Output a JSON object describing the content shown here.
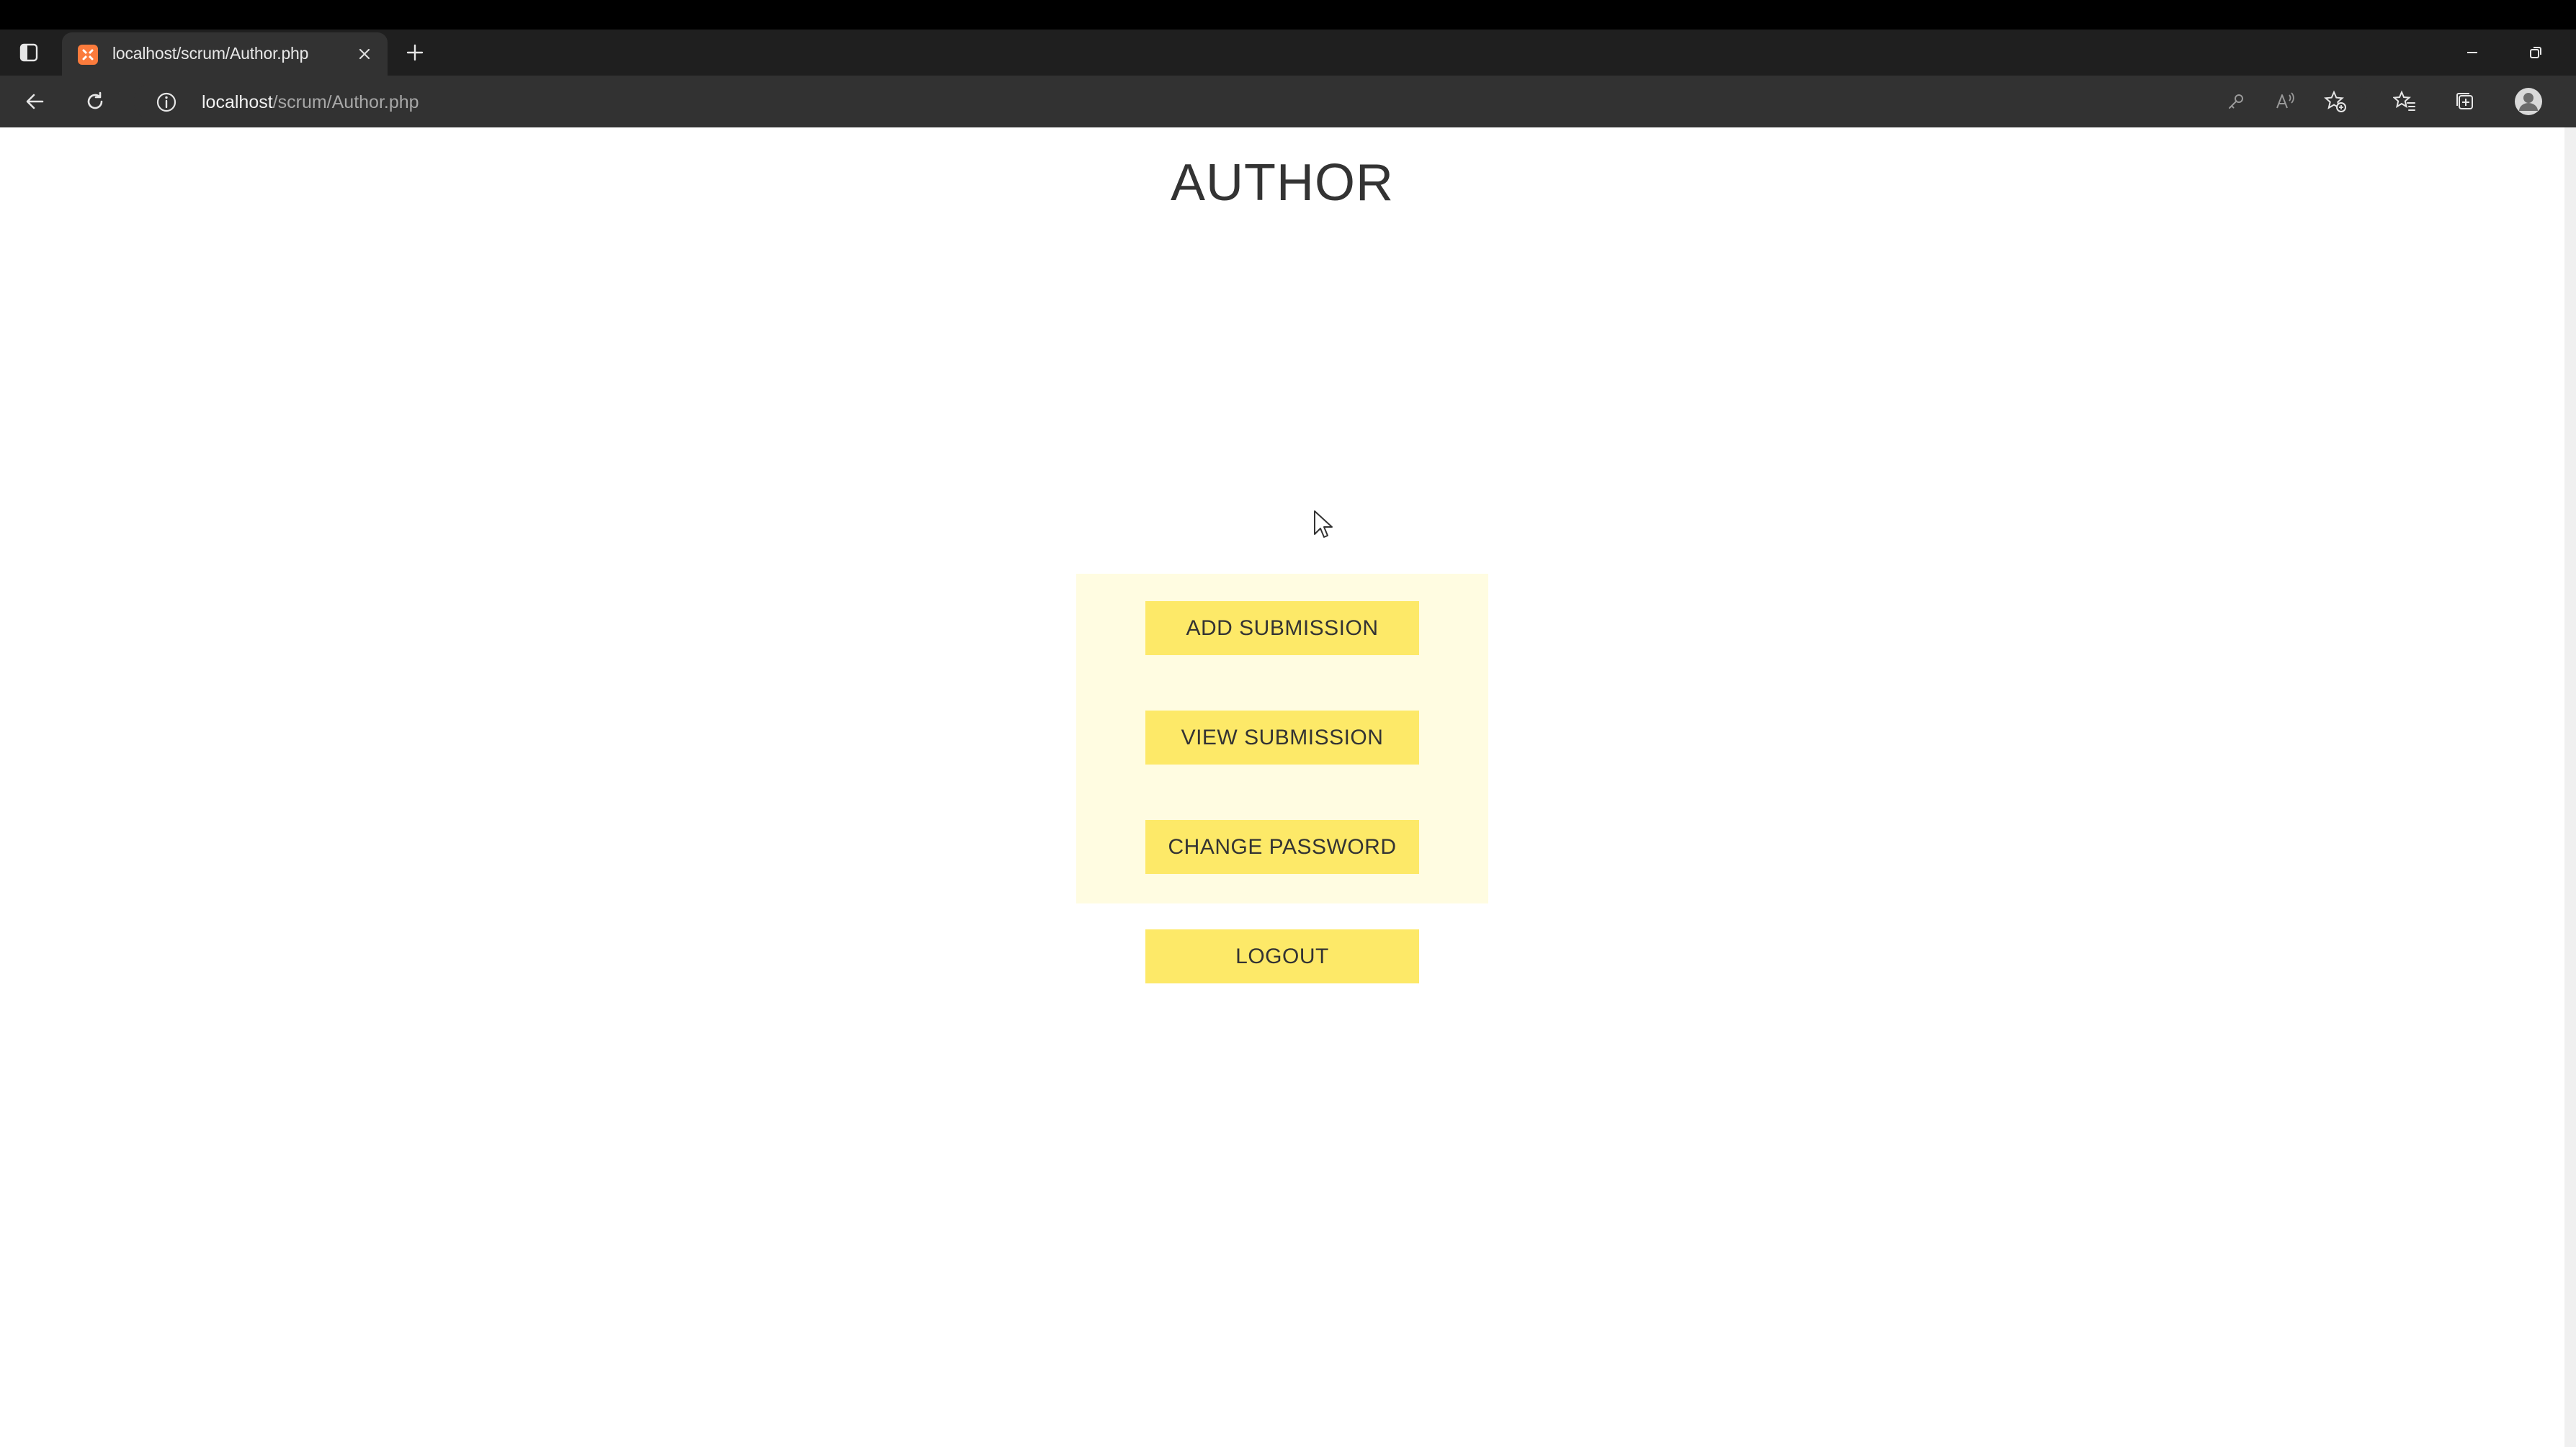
{
  "browser": {
    "tab": {
      "title": "localhost/scrum/Author.php"
    },
    "address": {
      "host": "localhost",
      "path": "/scrum/Author.php"
    },
    "icons": {
      "tab_actions": "tab-actions-icon",
      "favicon": "xampp-favicon",
      "close": "close-icon",
      "new_tab": "plus-icon",
      "minimize": "minimize-icon",
      "restore": "restore-icon",
      "back": "back-arrow-icon",
      "reload": "reload-icon",
      "site_info": "info-icon",
      "password": "key-icon",
      "read_aloud": "read-aloud-icon",
      "add_favorite": "star-add-icon",
      "favorites": "favorites-icon",
      "collections": "collections-icon",
      "profile": "profile-avatar-icon"
    }
  },
  "page": {
    "title": "AUTHOR",
    "menu": {
      "add_submission": "ADD SUBMISSION",
      "view_submission": "VIEW SUBMISSION",
      "change_password": "CHANGE PASSWORD"
    },
    "logout": "LOGOUT"
  },
  "colors": {
    "panel_bg": "#fffce1",
    "button_bg": "#fde968",
    "title_text": "#333333",
    "chrome_dark": "#1f1f1f",
    "chrome_toolbar": "#323232"
  }
}
